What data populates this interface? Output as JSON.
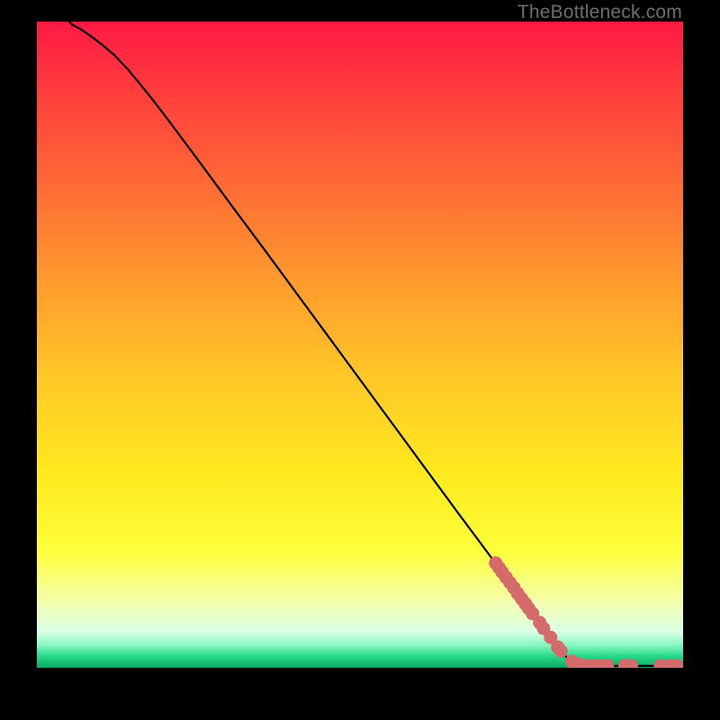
{
  "watermark": "TheBottleneck.com",
  "chart_data": {
    "type": "line",
    "title": "",
    "xlabel": "",
    "ylabel": "",
    "xlim": [
      0,
      100
    ],
    "ylim": [
      0,
      100
    ],
    "curve": [
      {
        "x": 5.0,
        "y": 100.0
      },
      {
        "x": 5.5,
        "y": 99.5
      },
      {
        "x": 6.5,
        "y": 99.0
      },
      {
        "x": 8.0,
        "y": 98.0
      },
      {
        "x": 10.0,
        "y": 96.5
      },
      {
        "x": 12.0,
        "y": 94.8
      },
      {
        "x": 14.0,
        "y": 92.7
      },
      {
        "x": 16.0,
        "y": 90.3
      },
      {
        "x": 18.0,
        "y": 87.8
      },
      {
        "x": 20.0,
        "y": 85.2
      },
      {
        "x": 25.0,
        "y": 78.5
      },
      {
        "x": 30.0,
        "y": 71.7
      },
      {
        "x": 35.0,
        "y": 65.0
      },
      {
        "x": 40.0,
        "y": 58.2
      },
      {
        "x": 45.0,
        "y": 51.4
      },
      {
        "x": 50.0,
        "y": 44.6
      },
      {
        "x": 55.0,
        "y": 37.8
      },
      {
        "x": 60.0,
        "y": 31.0
      },
      {
        "x": 65.0,
        "y": 24.2
      },
      {
        "x": 70.0,
        "y": 17.5
      },
      {
        "x": 75.0,
        "y": 10.7
      },
      {
        "x": 80.0,
        "y": 4.0
      },
      {
        "x": 82.0,
        "y": 1.6
      },
      {
        "x": 83.0,
        "y": 0.9
      },
      {
        "x": 84.0,
        "y": 0.5
      },
      {
        "x": 86.0,
        "y": 0.3
      },
      {
        "x": 90.0,
        "y": 0.3
      },
      {
        "x": 95.0,
        "y": 0.3
      },
      {
        "x": 100.0,
        "y": 0.3
      }
    ],
    "markers": [
      {
        "x": 71.0,
        "y": 16.2
      },
      {
        "x": 71.5,
        "y": 15.5
      },
      {
        "x": 72.0,
        "y": 14.8
      },
      {
        "x": 72.6,
        "y": 14.0
      },
      {
        "x": 73.2,
        "y": 13.2
      },
      {
        "x": 73.8,
        "y": 12.4
      },
      {
        "x": 74.4,
        "y": 11.5
      },
      {
        "x": 75.0,
        "y": 10.7
      },
      {
        "x": 75.6,
        "y": 9.9
      },
      {
        "x": 76.1,
        "y": 9.2
      },
      {
        "x": 76.7,
        "y": 8.4
      },
      {
        "x": 77.8,
        "y": 7.0
      },
      {
        "x": 78.4,
        "y": 6.1
      },
      {
        "x": 79.5,
        "y": 4.7
      },
      {
        "x": 80.6,
        "y": 3.2
      },
      {
        "x": 81.1,
        "y": 2.6
      },
      {
        "x": 82.8,
        "y": 1.0
      },
      {
        "x": 83.9,
        "y": 0.5
      },
      {
        "x": 85.0,
        "y": 0.3
      },
      {
        "x": 86.0,
        "y": 0.3
      },
      {
        "x": 87.2,
        "y": 0.3
      },
      {
        "x": 88.3,
        "y": 0.3
      },
      {
        "x": 91.0,
        "y": 0.3
      },
      {
        "x": 92.0,
        "y": 0.3
      },
      {
        "x": 96.5,
        "y": 0.3
      },
      {
        "x": 98.0,
        "y": 0.3
      },
      {
        "x": 99.0,
        "y": 0.3
      }
    ],
    "gradient_stops": [
      {
        "offset": 0.0,
        "color": "#ff1a44"
      },
      {
        "offset": 0.1,
        "color": "#ff3a3d"
      },
      {
        "offset": 0.25,
        "color": "#ff6a36"
      },
      {
        "offset": 0.4,
        "color": "#ff9a2e"
      },
      {
        "offset": 0.55,
        "color": "#ffc827"
      },
      {
        "offset": 0.7,
        "color": "#ffe91f"
      },
      {
        "offset": 0.82,
        "color": "#fdff3a"
      },
      {
        "offset": 0.9,
        "color": "#f4ffb0"
      },
      {
        "offset": 0.945,
        "color": "#d8ffe6"
      },
      {
        "offset": 0.965,
        "color": "#87f7c0"
      },
      {
        "offset": 0.982,
        "color": "#28d98a"
      },
      {
        "offset": 1.0,
        "color": "#0aa860"
      }
    ],
    "marker_color": "#d46a6a",
    "curve_color": "#000000"
  }
}
